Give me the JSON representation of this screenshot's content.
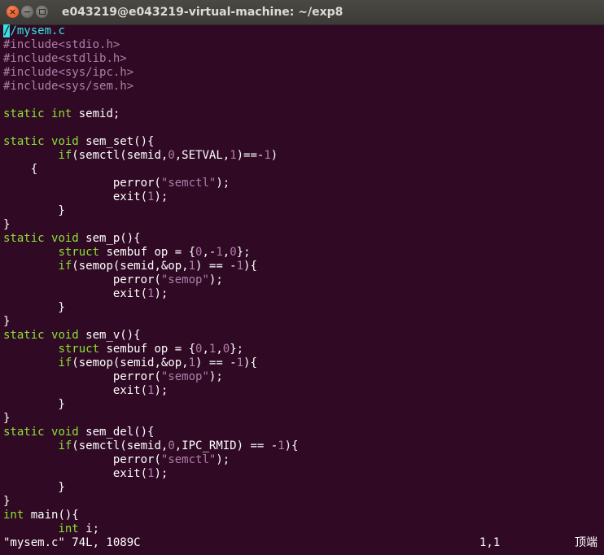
{
  "window": {
    "title": "e043219@e043219-virtual-machine: ~/exp8",
    "close_glyph": "×",
    "min_glyph": "−"
  },
  "editor": {
    "lines": [
      [
        {
          "t": "/",
          "c": "cursor"
        },
        {
          "t": "/mysem.c",
          "c": "cmt"
        }
      ],
      [
        {
          "t": "#include",
          "c": "pp"
        },
        {
          "t": "<stdio.h>",
          "c": "pp"
        }
      ],
      [
        {
          "t": "#include",
          "c": "pp"
        },
        {
          "t": "<stdlib.h>",
          "c": "pp"
        }
      ],
      [
        {
          "t": "#include",
          "c": "pp"
        },
        {
          "t": "<sys/ipc.h>",
          "c": "pp"
        }
      ],
      [
        {
          "t": "#include",
          "c": "pp"
        },
        {
          "t": "<sys/sem.h>",
          "c": "pp"
        }
      ],
      [],
      [
        {
          "t": "static",
          "c": "kw"
        },
        {
          "t": " "
        },
        {
          "t": "int",
          "c": "ty"
        },
        {
          "t": " semid;"
        }
      ],
      [],
      [
        {
          "t": "static",
          "c": "kw"
        },
        {
          "t": " "
        },
        {
          "t": "void",
          "c": "ty"
        },
        {
          "t": " sem_set(){"
        }
      ],
      [
        {
          "t": "        "
        },
        {
          "t": "if",
          "c": "kw"
        },
        {
          "t": "(semctl(semid,"
        },
        {
          "t": "0",
          "c": "num"
        },
        {
          "t": ",SETVAL,"
        },
        {
          "t": "1",
          "c": "num"
        },
        {
          "t": ")==-"
        },
        {
          "t": "1",
          "c": "num"
        },
        {
          "t": ")"
        }
      ],
      [
        {
          "t": "    {"
        }
      ],
      [
        {
          "t": "                perror("
        },
        {
          "t": "\"semctl\"",
          "c": "str"
        },
        {
          "t": ");"
        }
      ],
      [
        {
          "t": "                exit("
        },
        {
          "t": "1",
          "c": "num"
        },
        {
          "t": ");"
        }
      ],
      [
        {
          "t": "        }"
        }
      ],
      [
        {
          "t": "}"
        }
      ],
      [
        {
          "t": "static",
          "c": "kw"
        },
        {
          "t": " "
        },
        {
          "t": "void",
          "c": "ty"
        },
        {
          "t": " sem_p(){"
        }
      ],
      [
        {
          "t": "        "
        },
        {
          "t": "struct",
          "c": "kw"
        },
        {
          "t": " sembuf op = {"
        },
        {
          "t": "0",
          "c": "num"
        },
        {
          "t": ",-"
        },
        {
          "t": "1",
          "c": "num"
        },
        {
          "t": ","
        },
        {
          "t": "0",
          "c": "num"
        },
        {
          "t": "};"
        }
      ],
      [
        {
          "t": "        "
        },
        {
          "t": "if",
          "c": "kw"
        },
        {
          "t": "(semop(semid,&op,"
        },
        {
          "t": "1",
          "c": "num"
        },
        {
          "t": ") == -"
        },
        {
          "t": "1",
          "c": "num"
        },
        {
          "t": "){"
        }
      ],
      [
        {
          "t": "                perror("
        },
        {
          "t": "\"semop\"",
          "c": "str"
        },
        {
          "t": ");"
        }
      ],
      [
        {
          "t": "                exit("
        },
        {
          "t": "1",
          "c": "num"
        },
        {
          "t": ");"
        }
      ],
      [
        {
          "t": "        }"
        }
      ],
      [
        {
          "t": "}"
        }
      ],
      [
        {
          "t": "static",
          "c": "kw"
        },
        {
          "t": " "
        },
        {
          "t": "void",
          "c": "ty"
        },
        {
          "t": " sem_v(){"
        }
      ],
      [
        {
          "t": "        "
        },
        {
          "t": "struct",
          "c": "kw"
        },
        {
          "t": " sembuf op = {"
        },
        {
          "t": "0",
          "c": "num"
        },
        {
          "t": ","
        },
        {
          "t": "1",
          "c": "num"
        },
        {
          "t": ","
        },
        {
          "t": "0",
          "c": "num"
        },
        {
          "t": "};"
        }
      ],
      [
        {
          "t": "        "
        },
        {
          "t": "if",
          "c": "kw"
        },
        {
          "t": "(semop(semid,&op,"
        },
        {
          "t": "1",
          "c": "num"
        },
        {
          "t": ") == -"
        },
        {
          "t": "1",
          "c": "num"
        },
        {
          "t": "){"
        }
      ],
      [
        {
          "t": "                perror("
        },
        {
          "t": "\"semop\"",
          "c": "str"
        },
        {
          "t": ");"
        }
      ],
      [
        {
          "t": "                exit("
        },
        {
          "t": "1",
          "c": "num"
        },
        {
          "t": ");"
        }
      ],
      [
        {
          "t": "        }"
        }
      ],
      [
        {
          "t": "}"
        }
      ],
      [
        {
          "t": "static",
          "c": "kw"
        },
        {
          "t": " "
        },
        {
          "t": "void",
          "c": "ty"
        },
        {
          "t": " sem_del(){"
        }
      ],
      [
        {
          "t": "        "
        },
        {
          "t": "if",
          "c": "kw"
        },
        {
          "t": "(semctl(semid,"
        },
        {
          "t": "0",
          "c": "num"
        },
        {
          "t": ",IPC_RMID) == -"
        },
        {
          "t": "1",
          "c": "num"
        },
        {
          "t": "){"
        }
      ],
      [
        {
          "t": "                perror("
        },
        {
          "t": "\"semctl\"",
          "c": "str"
        },
        {
          "t": ");"
        }
      ],
      [
        {
          "t": "                exit("
        },
        {
          "t": "1",
          "c": "num"
        },
        {
          "t": ");"
        }
      ],
      [
        {
          "t": "        }"
        }
      ],
      [
        {
          "t": "}"
        }
      ],
      [
        {
          "t": "int",
          "c": "ty"
        },
        {
          "t": " main(){"
        }
      ],
      [
        {
          "t": "        "
        },
        {
          "t": "int",
          "c": "ty"
        },
        {
          "t": " i;"
        }
      ]
    ]
  },
  "status": {
    "file_info": "\"mysem.c\" 74L, 1089C",
    "cursor_pos": "1,1",
    "scroll_pos": "顶端"
  },
  "colors": {
    "background": "#300a24",
    "comment": "#34e2e2",
    "preprocessor": "#ad7fa8",
    "keyword": "#8ae234",
    "number": "#ad7fa8",
    "string": "#ad7fa8",
    "text": "#ffffff"
  }
}
